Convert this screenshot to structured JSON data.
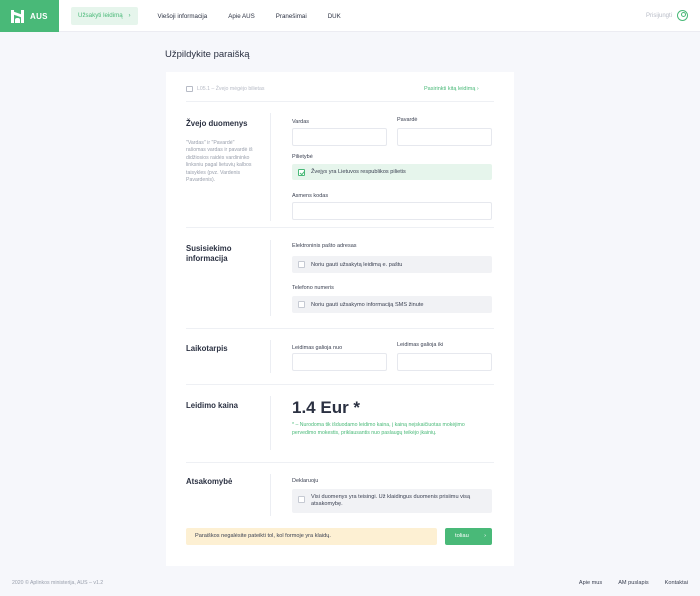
{
  "header": {
    "brand": "AUS",
    "nav": [
      {
        "label": "Užsakyti leidimą",
        "active": true
      },
      {
        "label": "Viešoji informacija"
      },
      {
        "label": "Apie AUS"
      },
      {
        "label": "Pranešimai"
      },
      {
        "label": "DUK"
      }
    ],
    "chevron": "›",
    "login_label": "Prisijungti",
    "accent_color": "#49b978"
  },
  "page": {
    "title": "Užpildykite paraišką"
  },
  "form": {
    "license_label": "L05.1 – Žvejo mėgėjo bilietas",
    "change_link": "Pasirinkti kitą leidimą ›",
    "sections": {
      "fisher": {
        "title": "Žvejo duomenys",
        "note": "\"Vardas\" ir \"Pavardė\" rašomas vardas ir pavardė iš didžiosios raidės vardininko linksniu pagal lietuvių kalbos taisykles (pvz. Vardenis Pavardenis).",
        "first_name_label": "Vardas",
        "first_name_value": "",
        "last_name_label": "Pavardė",
        "last_name_value": "",
        "citizenship_label": "Pilietybė",
        "citizenship_option": "Žvejys yra Lietuvos respublikos pilietis",
        "citizenship_checked": true,
        "personal_code_label": "Asmens kodas",
        "personal_code_value": ""
      },
      "contact": {
        "title": "Susisiekimo informacija",
        "email_label": "Elektroninis pašto adresas",
        "email_option": "Noriu gauti užsakytą leidimą e. paštu",
        "phone_label": "Telefono numeris",
        "phone_option": "Noriu gauti užsakymo informaciją SMS žinute"
      },
      "period": {
        "title": "Laikotarpis",
        "from_label": "Leidimas galioja nuo",
        "from_value": "",
        "to_label": "Leidimas galioja iki",
        "to_value": ""
      },
      "price": {
        "title": "Leidimo kaina",
        "amount": "1.4 Eur *",
        "note": "* – Nurodoma tik išduodamo leidimo kaina, į kainą neįskaičiuotas mokėjimo pervedimo mokestis, priklausantis nuo paslaugų teikėjo įkainių."
      },
      "responsibility": {
        "title": "Atsakomybė",
        "declaration_label": "Deklaruoju",
        "declaration_text": "Visi duomenys yra teisingi. Už klaidingus duomenis prisiimu visą atsakomybę."
      }
    },
    "warning": "Paraiškos negalėsite pateikti tol, kol formoje yra klaidų.",
    "next_button": "toliau",
    "next_chevron": "›"
  },
  "footer": {
    "copyright": "2020 © Aplinkos ministerija, AUS – v1.2",
    "links": [
      "Apie mus",
      "AM puslapis",
      "Kontaktai"
    ]
  }
}
